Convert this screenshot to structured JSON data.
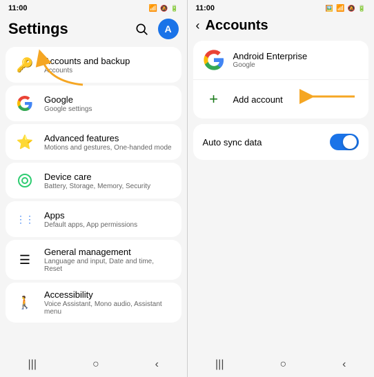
{
  "left": {
    "time": "11:00",
    "header_title": "Settings",
    "items": [
      {
        "id": "accounts-backup",
        "icon": "🔑",
        "icon_color": "#f5a623",
        "title": "Accounts and backup",
        "subtitle": "Accounts"
      },
      {
        "id": "google",
        "icon": "G",
        "icon_type": "google",
        "title": "Google",
        "subtitle": "Google settings"
      },
      {
        "id": "advanced",
        "icon": "⚙️",
        "title": "Advanced features",
        "subtitle": "Motions and gestures, One-handed mode"
      },
      {
        "id": "device-care",
        "icon": "◎",
        "title": "Device care",
        "subtitle": "Battery, Storage, Memory, Security"
      },
      {
        "id": "apps",
        "icon": "⋮⋮",
        "title": "Apps",
        "subtitle": "Default apps, App permissions"
      },
      {
        "id": "general",
        "icon": "≡",
        "title": "General management",
        "subtitle": "Language and input, Date and time, Reset"
      },
      {
        "id": "accessibility",
        "icon": "♿",
        "title": "Accessibility",
        "subtitle": "Voice Assistant, Mono audio, Assistant menu"
      }
    ],
    "nav": [
      "|||",
      "○",
      "<"
    ]
  },
  "right": {
    "time": "11:00",
    "back_label": "<",
    "title": "Accounts",
    "account_name": "Android Enterprise",
    "account_type": "Google",
    "add_account_label": "Add account",
    "sync_label": "Auto sync data",
    "sync_on": true,
    "nav": [
      "|||",
      "○",
      "<"
    ]
  },
  "arrows": {
    "left_arrow_visible": true,
    "right_arrow_visible": true
  }
}
